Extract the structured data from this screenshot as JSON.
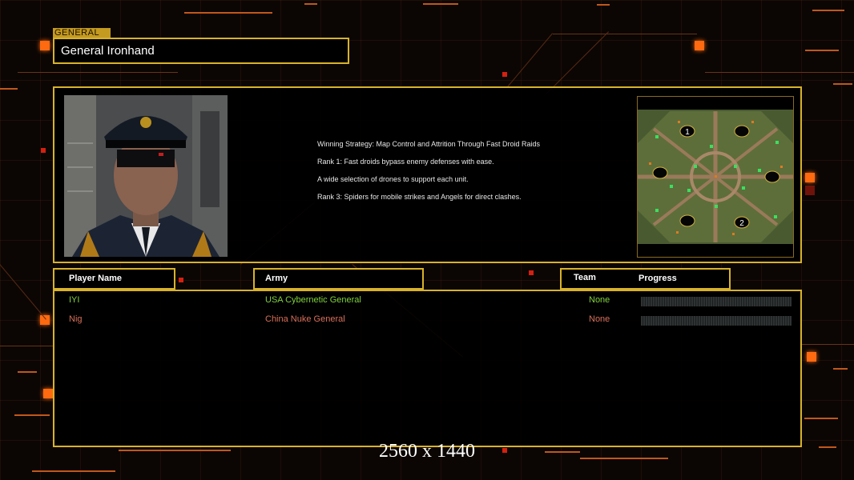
{
  "header": {
    "section_tag": "GENERAL",
    "general_name": "General Ironhand"
  },
  "strategy": {
    "lines": [
      "Winning Strategy: Map Control and Attrition Through Fast Droid Raids",
      "Rank 1: Fast droids bypass enemy defenses with ease.",
      "A wide selection of drones to support each unit.",
      "Rank 3: Spiders for mobile strikes and Angels for direct clashes."
    ]
  },
  "minimap": {
    "start_labels": [
      "1",
      "2"
    ]
  },
  "columns": {
    "player": "Player Name",
    "army": "Army",
    "team": "Team",
    "progress": "Progress"
  },
  "players": [
    {
      "name": "IYI",
      "army": "USA Cybernetic General",
      "team": "None",
      "color": "#7fd23a"
    },
    {
      "name": "Nig",
      "army": "China Nuke General",
      "team": "None",
      "color": "#d8705a"
    }
  ],
  "resolution_label": "2560 x 1440",
  "colors": {
    "accent": "#d8b22a",
    "deco_orange": "#ff6a10",
    "background": "#0a0604"
  }
}
